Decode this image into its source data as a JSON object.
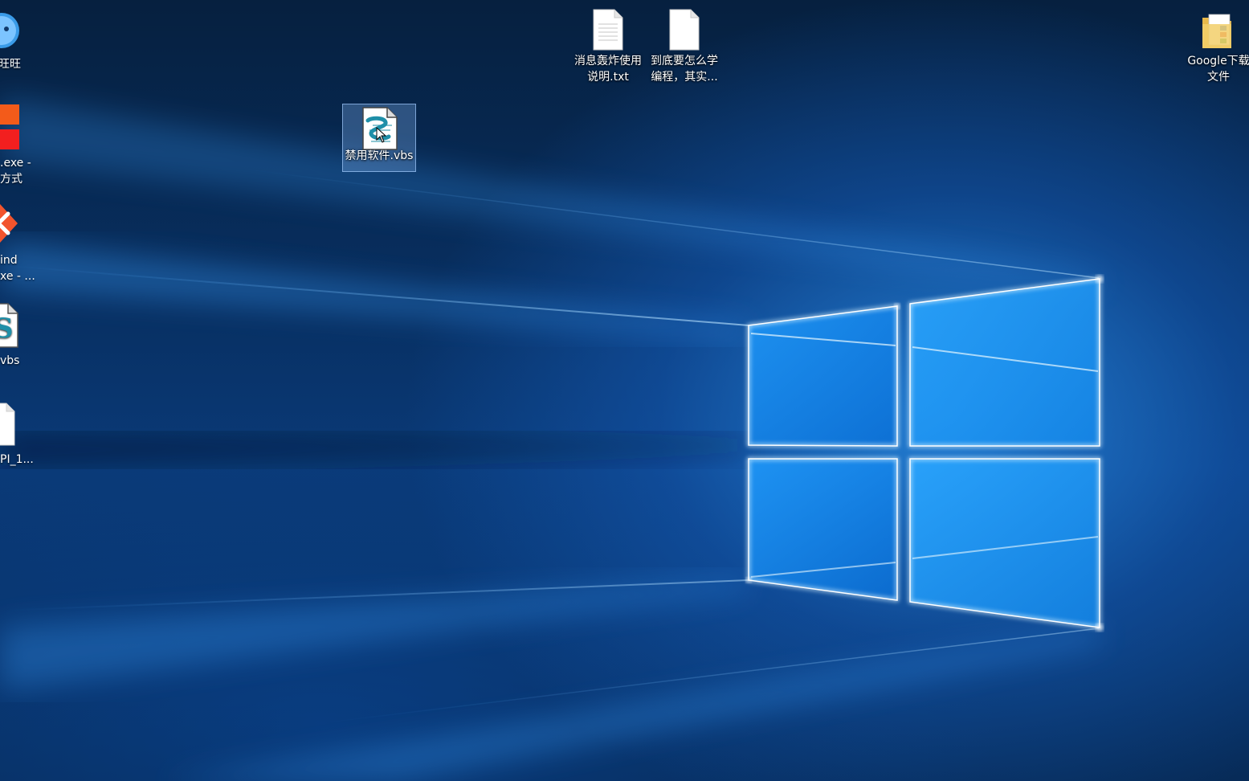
{
  "desktop": {
    "left_icons": [
      {
        "label_line1": "旺旺",
        "label_line2": ""
      },
      {
        "label_line1": ".exe -",
        "label_line2": "方式"
      },
      {
        "label_line1": "ind",
        "label_line2": "xe - ..."
      },
      {
        "label_line1": "vbs",
        "label_line2": ""
      },
      {
        "label_line1": "PI_1...",
        "label_line2": ""
      }
    ],
    "icons": [
      {
        "label_line1": "消息轰炸使用",
        "label_line2": "说明.txt",
        "icon": "text-file-icon"
      },
      {
        "label_line1": "到底要怎么学",
        "label_line2": "编程，其实...",
        "icon": "text-file-icon"
      },
      {
        "label_line1": "Google下载",
        "label_line2": "文件",
        "icon": "folder-icon"
      },
      {
        "label_line1": "禁用软件.vbs",
        "label_line2": "",
        "icon": "vbs-script-icon"
      }
    ]
  },
  "colors": {
    "wallpaper_dark": "#06203f",
    "wallpaper_glow": "#2a8fe6",
    "logo_light": "#7fd0ff",
    "selection": "#78aae6"
  }
}
